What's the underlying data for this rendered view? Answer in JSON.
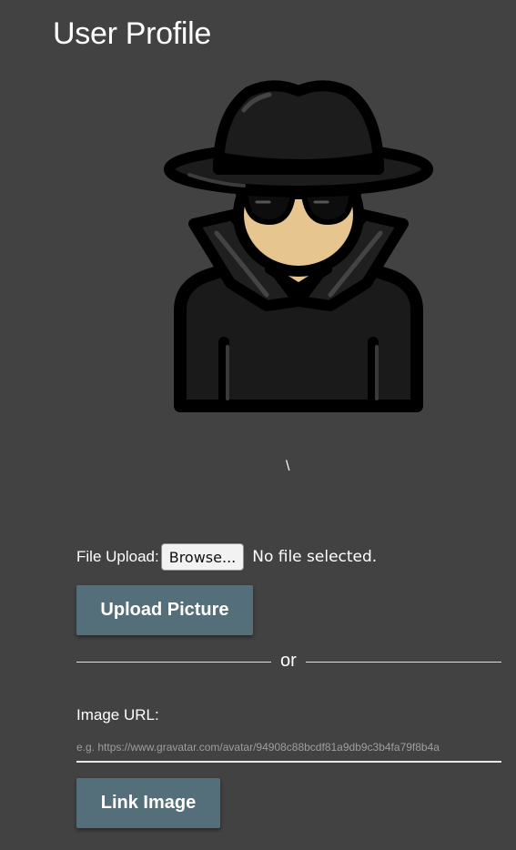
{
  "page": {
    "title": "User Profile"
  },
  "avatar": {
    "icon": "spy-avatar-icon"
  },
  "stray_text": "\\",
  "upload": {
    "label": "File Upload:",
    "browse_label": "Browse...",
    "status": "No file selected.",
    "button_label": "Upload Picture"
  },
  "divider": {
    "text": "or"
  },
  "image_url": {
    "label": "Image URL:",
    "placeholder": "e.g. https://www.gravatar.com/avatar/94908c88bcdf81a9db9c3b4fa79f8b4a",
    "value": "",
    "button_label": "Link Image"
  },
  "colors": {
    "background": "#424242",
    "button": "#546e7a",
    "text": "#ffffff"
  }
}
